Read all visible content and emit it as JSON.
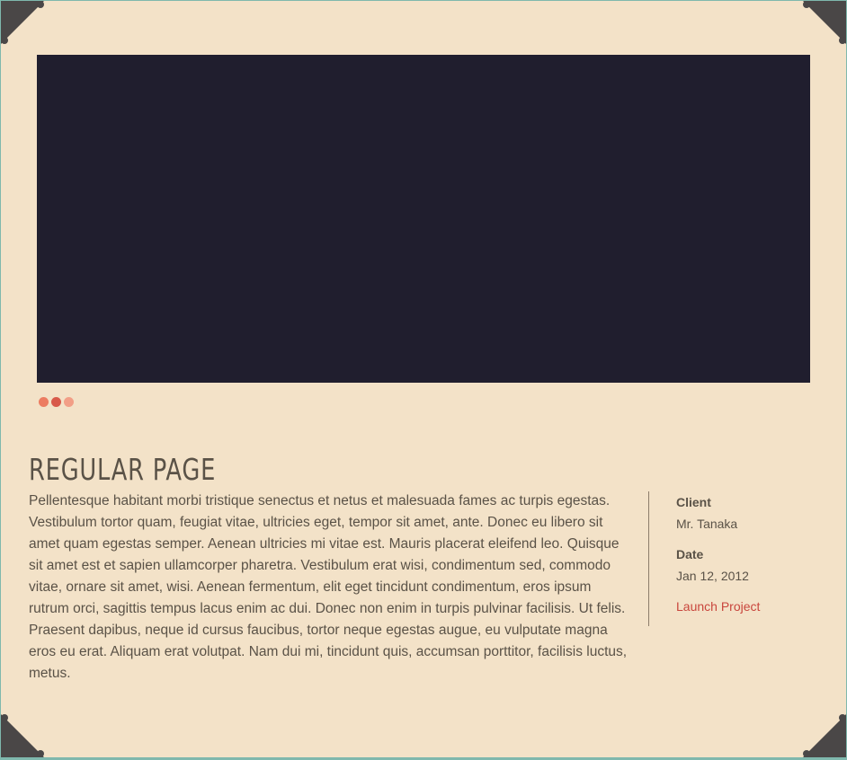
{
  "colors": {
    "page_background": "#f3e2c8",
    "outer_border": "#7fb8ad",
    "slider_background": "#201e2e",
    "text": "#5a5247",
    "link": "#c9463d",
    "corner": "#4a4747",
    "dots": [
      "#ec7c61",
      "#d8594a",
      "#f29e86"
    ]
  },
  "slider": {
    "dots": [
      {
        "label": "slide-1"
      },
      {
        "label": "slide-2",
        "active": true
      },
      {
        "label": "slide-3"
      }
    ]
  },
  "page": {
    "title": "REGULAR PAGE",
    "body": "Pellentesque habitant morbi tristique senectus et netus et malesuada fames ac turpis egestas. Vestibulum tortor quam, feugiat vitae, ultricies eget, tempor sit amet, ante. Donec eu libero sit amet quam egestas semper. Aenean ultricies mi vitae est. Mauris placerat eleifend leo. Quisque sit amet est et sapien ullamcorper pharetra. Vestibulum erat wisi, condimentum sed, commodo vitae, ornare sit amet, wisi. Aenean fermentum, elit eget tincidunt condimentum, eros ipsum rutrum orci, sagittis tempus lacus enim ac dui. Donec non enim in turpis pulvinar facilisis. Ut felis. Praesent dapibus, neque id cursus faucibus, tortor neque egestas augue, eu vulputate magna eros eu erat. Aliquam erat volutpat. Nam dui mi, tincidunt quis, accumsan porttitor, facilisis luctus, metus."
  },
  "meta": {
    "client_label": "Client",
    "client_value": "Mr. Tanaka",
    "date_label": "Date",
    "date_value": "Jan 12, 2012",
    "launch_label": "Launch Project"
  }
}
